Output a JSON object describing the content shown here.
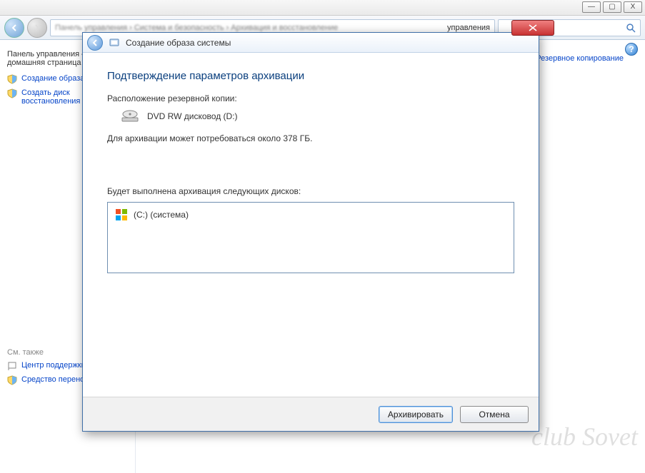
{
  "window_controls": {
    "min": "—",
    "max": "▢",
    "close": "X"
  },
  "explorer": {
    "address_trail": "управления",
    "search_placeholder": ""
  },
  "cp": {
    "header": "Панель управления — домашняя страница",
    "link_create_image": "Создание образа системы",
    "link_create_disc": "Создать диск восстановления системы",
    "see_also": "См. также",
    "link_action_center": "Центр поддержки",
    "link_easy_transfer": "Средство переноса Windows",
    "right_link": "Резервное копирование"
  },
  "dialog": {
    "title": "Создание образа системы",
    "heading": "Подтверждение параметров архивации",
    "location_label": "Расположение резервной копии:",
    "dvd_label": "DVD RW дисковод (D:)",
    "size_note": "Для архивации может потребоваться около 378 ГБ.",
    "disks_label": "Будет выполнена архивация следующих дисков:",
    "disk_c": "(C:) (система)",
    "btn_start": "Архивировать",
    "btn_cancel": "Отмена"
  }
}
